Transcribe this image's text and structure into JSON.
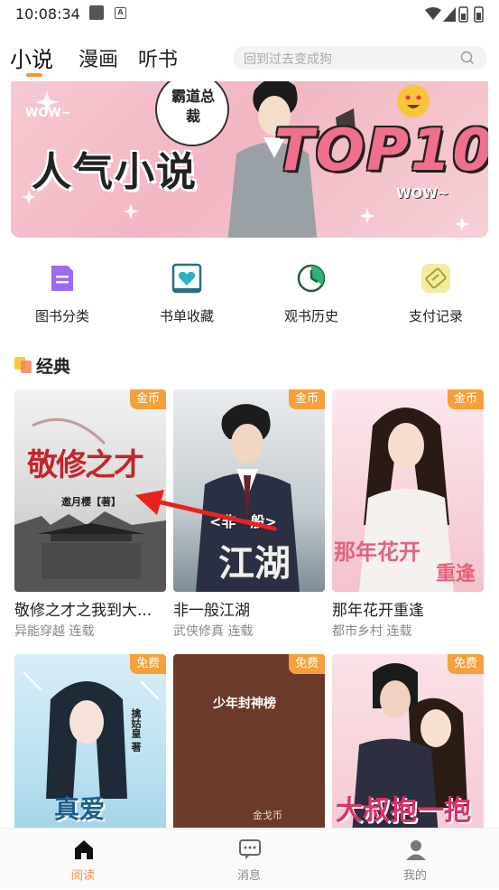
{
  "status_bar": {
    "time": "10:08:34"
  },
  "header": {
    "tabs": [
      {
        "label": "小说",
        "active": true
      },
      {
        "label": "漫画",
        "active": false
      },
      {
        "label": "听书",
        "active": false
      }
    ],
    "search": {
      "placeholder": "回到过去变成狗"
    }
  },
  "banner": {
    "title": "人气小说",
    "highlight": "TOP10",
    "wow_left": "WOW~",
    "wow_right": "WOW~",
    "bubble_text": "霸道总裁"
  },
  "quick_links": [
    {
      "label": "图书分类",
      "icon": "book-category-icon",
      "color": "#9b6bf0"
    },
    {
      "label": "书单收藏",
      "icon": "heart-frame-icon",
      "color": "#2a9fc1"
    },
    {
      "label": "观书历史",
      "icon": "clock-icon",
      "color": "#2fb07a"
    },
    {
      "label": "支付记录",
      "icon": "ticket-icon",
      "color": "#c8c23c"
    }
  ],
  "section": {
    "title": "经典"
  },
  "books": [
    {
      "title": "敬修之才之我到大...",
      "genre": "异能穿越",
      "status": "连载",
      "badge": "金币",
      "cover_text": "敬修之才",
      "cover_sub": "邀月樱【著】"
    },
    {
      "title": "非一般江湖",
      "genre": "武侠修真",
      "status": "连载",
      "badge": "金币",
      "cover_text": "江湖",
      "cover_sub": "<非一般>"
    },
    {
      "title": "那年花开重逢",
      "genre": "都市乡村",
      "status": "连载",
      "badge": "金币",
      "cover_text": "那年花开",
      "cover_sub": "重逢"
    },
    {
      "title": "",
      "genre": "",
      "status": "",
      "badge": "免费",
      "cover_text": "真爱",
      "cover_sub": "擒姑皇 著"
    },
    {
      "title": "",
      "genre": "",
      "status": "",
      "badge": "免费",
      "cover_text": "少年封神榜",
      "cover_sub": "金戈币"
    },
    {
      "title": "",
      "genre": "",
      "status": "",
      "badge": "免费",
      "cover_text": "大叔抱一抱",
      "cover_sub": ""
    }
  ],
  "bottom_nav": [
    {
      "label": "阅读",
      "icon": "home-icon",
      "active": true
    },
    {
      "label": "消息",
      "icon": "message-icon",
      "active": false
    },
    {
      "label": "我的",
      "icon": "profile-icon",
      "active": false
    }
  ],
  "colors": {
    "accent": "#f5923e",
    "badge": "#f5a03a"
  }
}
